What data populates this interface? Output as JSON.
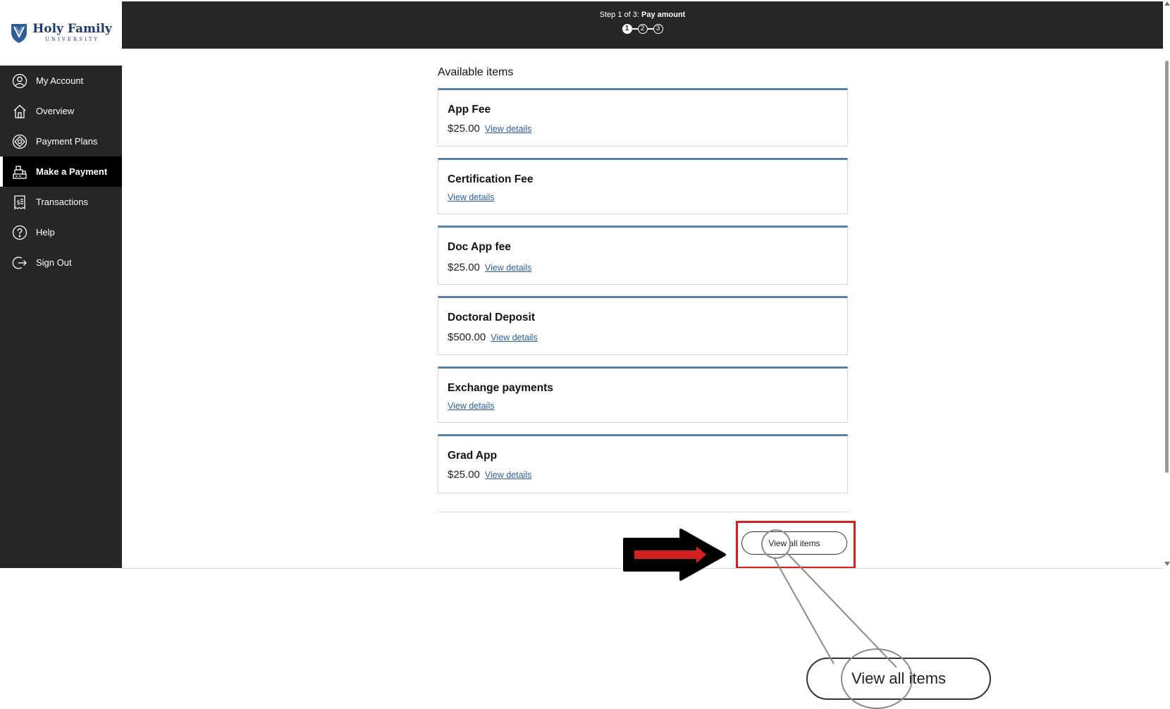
{
  "brand": {
    "name": "Holy Family",
    "subtitle": "UNIVERSITY",
    "accent": "#1e3a6a"
  },
  "header": {
    "step_prefix": "Step 1 of 3:",
    "step_title": "Pay amount",
    "steps": [
      "1",
      "2",
      "3"
    ],
    "current_step": 1
  },
  "sidebar": {
    "items": [
      {
        "label": "My Account",
        "icon": "user-circle-icon",
        "active": false
      },
      {
        "label": "Overview",
        "icon": "home-icon",
        "active": false
      },
      {
        "label": "Payment Plans",
        "icon": "payment-plans-icon",
        "active": false
      },
      {
        "label": "Make a Payment",
        "icon": "register-icon",
        "active": true
      },
      {
        "label": "Transactions",
        "icon": "receipt-icon",
        "active": false
      },
      {
        "label": "Help",
        "icon": "help-icon",
        "active": false
      },
      {
        "label": "Sign Out",
        "icon": "sign-out-icon",
        "active": false
      }
    ]
  },
  "main": {
    "section_title": "Available items",
    "items": [
      {
        "title": "App Fee",
        "price": "$25.00",
        "link": "View details"
      },
      {
        "title": "Certification Fee",
        "price": "",
        "link": "View details"
      },
      {
        "title": "Doc App fee",
        "price": "$25.00",
        "link": "View details"
      },
      {
        "title": "Doctoral Deposit",
        "price": "$500.00",
        "link": "View details"
      },
      {
        "title": "Exchange payments",
        "price": "",
        "link": "View details"
      },
      {
        "title": "Grad App",
        "price": "$25.00",
        "link": "View details"
      }
    ],
    "view_all_label": "View all items"
  },
  "annotation": {
    "zoom_label": "View all items",
    "highlight_color": "#d32020",
    "arrow_color": "#d32020"
  }
}
